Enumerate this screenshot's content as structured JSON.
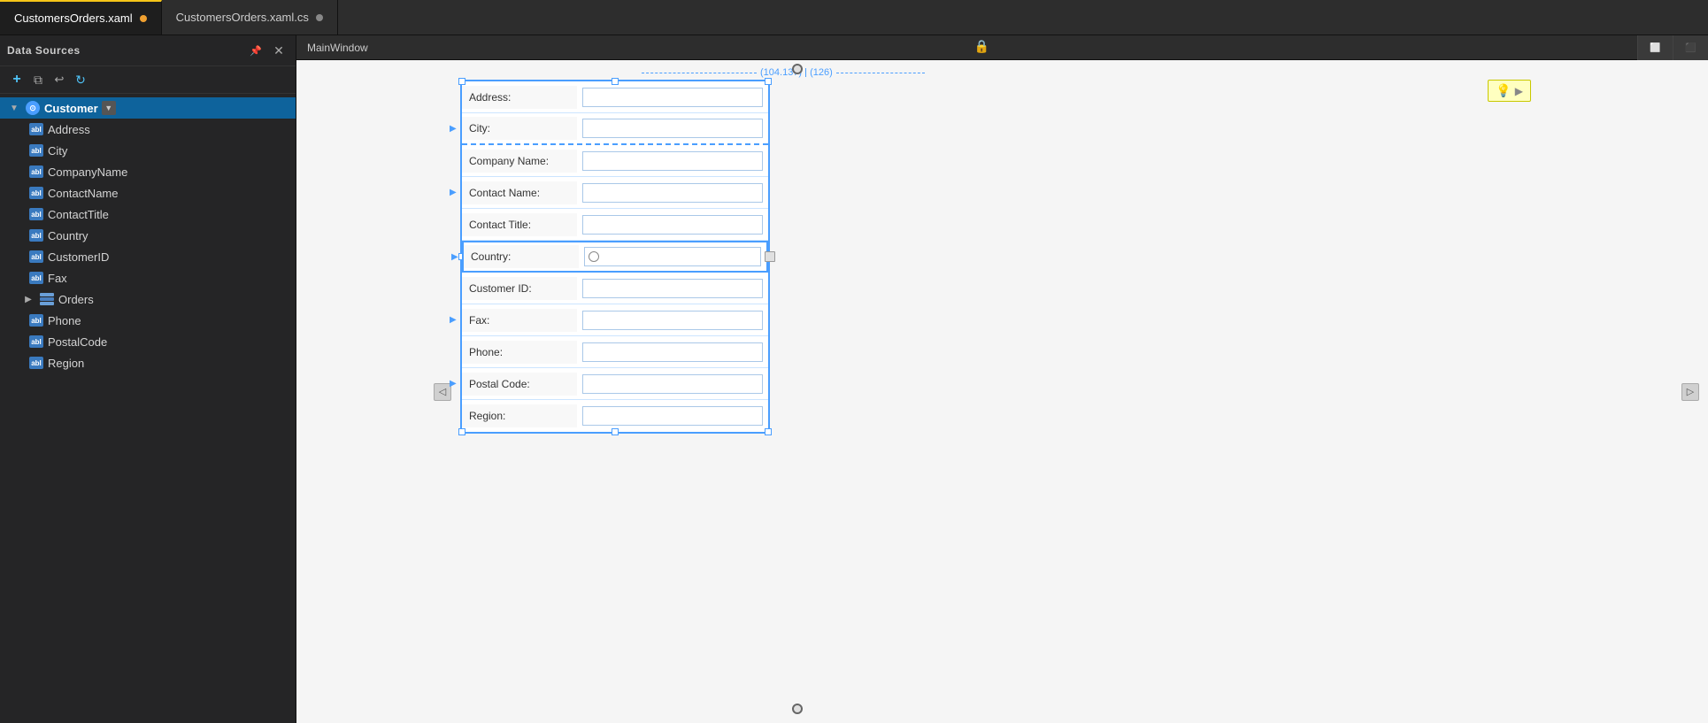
{
  "tabs": [
    {
      "id": "xaml",
      "label": "CustomersOrders.xaml",
      "active": true,
      "modified": true
    },
    {
      "id": "cs",
      "label": "CustomersOrders.xaml.cs",
      "active": false,
      "modified": false
    }
  ],
  "sidebar": {
    "title": "Data Sources",
    "toolbar": {
      "add_label": "+",
      "copy_label": "⧉",
      "back_label": "↩",
      "refresh_label": "↻",
      "pin_label": "📌",
      "close_label": "✕"
    },
    "tree": {
      "root": {
        "label": "Customer",
        "expanded": true,
        "selected": true,
        "children": [
          {
            "label": "Address",
            "type": "field"
          },
          {
            "label": "City",
            "type": "field"
          },
          {
            "label": "CompanyName",
            "type": "field"
          },
          {
            "label": "ContactName",
            "type": "field"
          },
          {
            "label": "ContactTitle",
            "type": "field"
          },
          {
            "label": "Country",
            "type": "field"
          },
          {
            "label": "CustomerID",
            "type": "field"
          },
          {
            "label": "Fax",
            "type": "field"
          },
          {
            "label": "Orders",
            "type": "table",
            "expandable": true
          },
          {
            "label": "Phone",
            "type": "field"
          },
          {
            "label": "PostalCode",
            "type": "field"
          },
          {
            "label": "Region",
            "type": "field"
          }
        ]
      }
    }
  },
  "window_label": "MainWindow",
  "design": {
    "measure_left": "(104.137)",
    "measure_right": "(126)",
    "form_fields": [
      {
        "label": "Address:",
        "type": "textbox",
        "row_has_arrow": false
      },
      {
        "label": "City:",
        "type": "textbox",
        "row_has_arrow": true,
        "dashed": true
      },
      {
        "label": "Company Name:",
        "type": "textbox",
        "row_has_arrow": false
      },
      {
        "label": "Contact Name:",
        "type": "textbox",
        "row_has_arrow": true
      },
      {
        "label": "Contact Title:",
        "type": "textbox",
        "row_has_arrow": false
      },
      {
        "label": "Country:",
        "type": "radio",
        "row_has_arrow": true
      },
      {
        "label": "Customer ID:",
        "type": "textbox",
        "row_has_arrow": false
      },
      {
        "label": "Fax:",
        "type": "textbox",
        "row_has_arrow": true
      },
      {
        "label": "Phone:",
        "type": "textbox",
        "row_has_arrow": false
      },
      {
        "label": "Postal Code:",
        "type": "textbox",
        "row_has_arrow": true
      },
      {
        "label": "Region:",
        "type": "textbox",
        "row_has_arrow": false
      }
    ]
  }
}
